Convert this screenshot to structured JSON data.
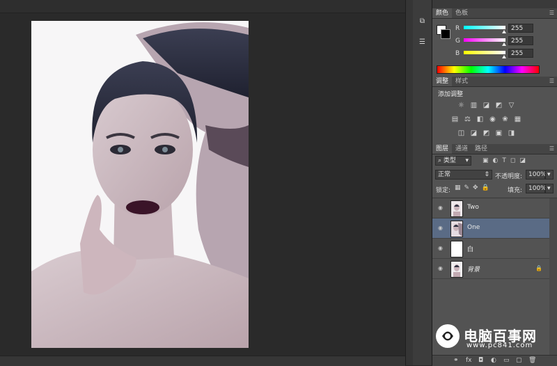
{
  "panels": {
    "color": {
      "tabs": [
        "颜色",
        "色板"
      ],
      "channels": [
        {
          "label": "R",
          "value": "255"
        },
        {
          "label": "G",
          "value": "255"
        },
        {
          "label": "B",
          "value": "255"
        }
      ]
    },
    "adjustments": {
      "tabs": [
        "调整",
        "样式"
      ],
      "title": "添加调整"
    },
    "layers": {
      "tabs": [
        "图层",
        "通道",
        "路径"
      ],
      "filter_kind": "类型",
      "blend_mode": "正常",
      "opacity_label": "不透明度:",
      "opacity_value": "100%",
      "lock_label": "锁定:",
      "fill_label": "填充:",
      "fill_value": "100%",
      "items": [
        {
          "name": "Two",
          "selected": false
        },
        {
          "name": "One",
          "selected": true
        },
        {
          "name": "白",
          "selected": false
        },
        {
          "name": "背景",
          "selected": false,
          "locked": true
        }
      ]
    }
  },
  "watermark": {
    "title": "电脑百事网",
    "url": "www.pc841.com"
  },
  "colors": {
    "selected_layer": "#5a6b85",
    "panel_bg": "#535353"
  },
  "icons": {
    "eye": "eye-icon",
    "lock": "lock-icon",
    "fx": "fx-icon"
  }
}
